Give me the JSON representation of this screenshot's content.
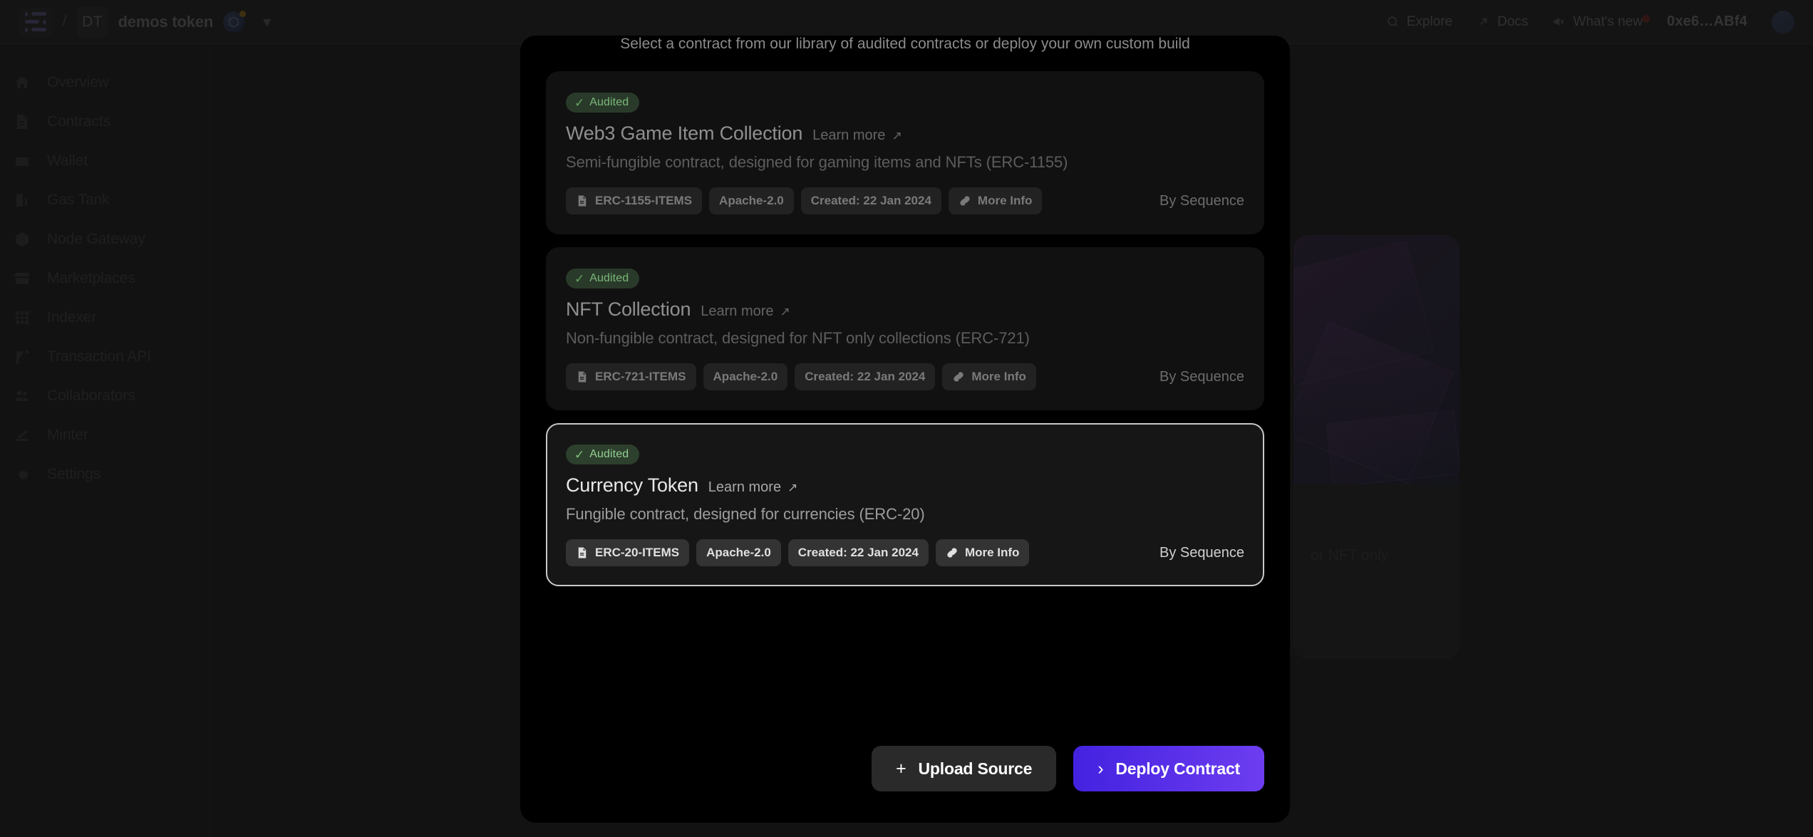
{
  "header": {
    "menu_icon": "menu-list-icon",
    "breadcrumb_separator": "/",
    "project_initials": "DT",
    "project_name": "demos token",
    "network_icon": "network-avatar-icon",
    "chevron": "⌄",
    "nav": [
      {
        "label": "Explore",
        "icon": "search-icon"
      },
      {
        "label": "Docs",
        "icon": "external-link-icon"
      },
      {
        "label": "What's new",
        "icon": "megaphone-icon",
        "badge": true
      }
    ],
    "wallet_address": "0xe6…ABf4",
    "avatar": "user-avatar"
  },
  "sidebar": {
    "items": [
      {
        "label": "Overview",
        "icon": "home-icon"
      },
      {
        "label": "Contracts",
        "icon": "contract-document-icon"
      },
      {
        "label": "Wallet",
        "icon": "wallet-icon"
      },
      {
        "label": "Gas Tank",
        "icon": "fuel-pump-icon"
      },
      {
        "label": "Node Gateway",
        "icon": "cube-icon"
      },
      {
        "label": "Marketplaces",
        "icon": "storefront-icon"
      },
      {
        "label": "Indexer",
        "icon": "grid-icon"
      },
      {
        "label": "Transaction API",
        "icon": "transaction-flow-icon"
      },
      {
        "label": "Collaborators",
        "icon": "people-icon"
      },
      {
        "label": "Minter",
        "icon": "stamp-icon"
      },
      {
        "label": "Settings",
        "icon": "gear-icon"
      }
    ]
  },
  "background": {
    "ghost_card_text": "or NFT only"
  },
  "modal": {
    "subtitle": "Select a contract from our library of audited contracts or deploy your own custom build",
    "cards": [
      {
        "badge": "Audited",
        "badge_icon": "check-icon",
        "title": "Web3 Game Item Collection",
        "learn_more": "Learn more",
        "learn_more_icon": "arrow-up-right-icon",
        "description": "Semi-fungible contract, designed for gaming items and NFTs (ERC-1155)",
        "pills": [
          {
            "label": "ERC-1155-ITEMS",
            "icon": "contract-document-icon"
          },
          {
            "label": "Apache-2.0",
            "icon": ""
          },
          {
            "label": "Created: 22 Jan 2024",
            "icon": ""
          },
          {
            "label": "More Info",
            "icon": "link-chain-icon"
          }
        ],
        "author": "By Sequence",
        "selected": false
      },
      {
        "badge": "Audited",
        "badge_icon": "check-icon",
        "title": "NFT Collection",
        "learn_more": "Learn more",
        "learn_more_icon": "arrow-up-right-icon",
        "description": "Non-fungible contract, designed for NFT only collections (ERC-721)",
        "pills": [
          {
            "label": "ERC-721-ITEMS",
            "icon": "contract-document-icon"
          },
          {
            "label": "Apache-2.0",
            "icon": ""
          },
          {
            "label": "Created: 22 Jan 2024",
            "icon": ""
          },
          {
            "label": "More Info",
            "icon": "link-chain-icon"
          }
        ],
        "author": "By Sequence",
        "selected": false
      },
      {
        "badge": "Audited",
        "badge_icon": "check-icon",
        "title": "Currency Token",
        "learn_more": "Learn more",
        "learn_more_icon": "arrow-up-right-icon",
        "description": "Fungible contract, designed for currencies (ERC-20)",
        "pills": [
          {
            "label": "ERC-20-ITEMS",
            "icon": "contract-document-icon"
          },
          {
            "label": "Apache-2.0",
            "icon": ""
          },
          {
            "label": "Created: 22 Jan 2024",
            "icon": ""
          },
          {
            "label": "More Info",
            "icon": "link-chain-icon"
          }
        ],
        "author": "By Sequence",
        "selected": true
      }
    ],
    "footer": {
      "upload_label": "Upload Source",
      "upload_icon": "plus-icon",
      "deploy_label": "Deploy Contract",
      "deploy_icon": "chevron-right-icon"
    }
  },
  "colors": {
    "accent": "#6d3df0",
    "accent_dark": "#4322e0",
    "audited_green": "#7ab87a",
    "modal_bg": "#000000",
    "page_bg": "#1c1c1c"
  }
}
